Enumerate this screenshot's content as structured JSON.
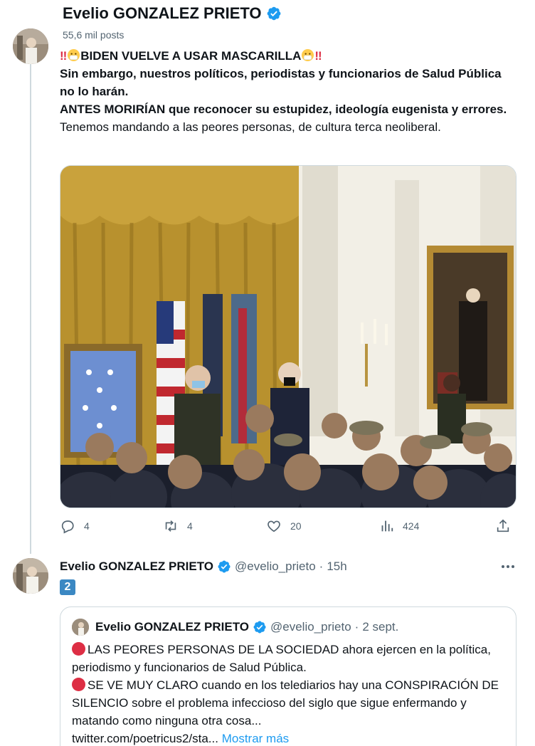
{
  "header": {
    "display_name": "Evelio GONZALEZ PRIETO",
    "posts_count": "55,6 mil posts"
  },
  "tweet1": {
    "line1": "BIDEN VUELVE A USAR MASCARILLA",
    "line2": "Sin embargo, nuestros políticos, periodistas y funcionarios de Salud Pública no lo harán.",
    "line3": "ANTES MORIRÍAN que reconocer su estupidez, ideología eugenista y errores.",
    "line4": "Tenemos mandando a las peores personas, de cultura terca neoliberal.",
    "photo_description_icon": "photo",
    "stats": {
      "replies": "4",
      "retweets": "4",
      "likes": "20",
      "views": "424"
    }
  },
  "tweet2": {
    "display_name": "Evelio GONZALEZ PRIETO",
    "handle": "@evelio_prieto",
    "separator": "·",
    "time": "15h",
    "badge": "2",
    "quote": {
      "display_name": "Evelio GONZALEZ PRIETO",
      "handle": "@evelio_prieto",
      "separator": "·",
      "time": "2 sept.",
      "para1": "LAS PEORES PERSONAS DE LA SOCIEDAD ahora ejercen en la política, periodismo y funcionarios de Salud Pública.",
      "para2": "SE VE MUY CLARO cuando en los telediarios hay una CONSPIRACIÓN DE SILENCIO sobre el problema infeccioso del siglo que sigue enfermando y matando como ninguna otra cosa...",
      "link": "twitter.com/poetricus2/sta...",
      "show_more": "Mostrar más"
    }
  },
  "colors": {
    "text": "#0f1419",
    "secondary": "#536471",
    "accent": "#1d9bf0",
    "border": "#cfd9de",
    "red_emoji": "#dd2e44",
    "badge_blue": "#3b88c3"
  }
}
